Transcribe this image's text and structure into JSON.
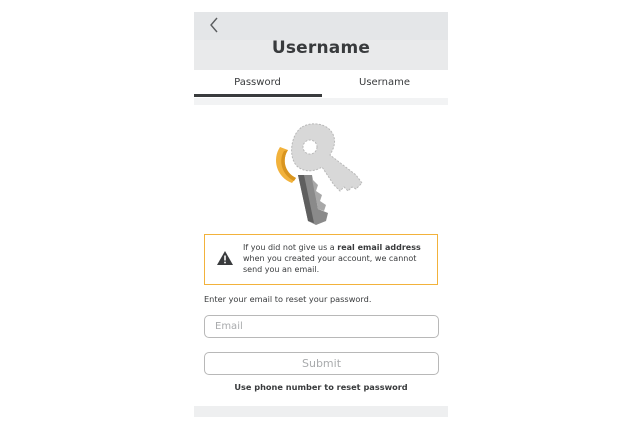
{
  "header": {
    "title": "Username",
    "back_icon": "chevron-left-icon"
  },
  "tabs": [
    {
      "label": "Password",
      "active": true
    },
    {
      "label": "Username",
      "active": false
    }
  ],
  "illustration": {
    "icon": "key-icon",
    "colors": {
      "ring": "#f2b23b",
      "key_gray": "#d4d4d4",
      "blade_dark": "#6e6e6e"
    }
  },
  "warning": {
    "icon": "warning-triangle-icon",
    "text_before": "If you did not give us a ",
    "text_bold": "real email address",
    "text_after": " when you created your account, we cannot send you an email.",
    "border_color": "#f2b23b"
  },
  "form": {
    "instruction": "Enter your email to reset your password.",
    "email_placeholder": "Email",
    "email_value": "",
    "submit_label": "Submit"
  },
  "links": {
    "phone_reset": "Use phone number to reset password"
  }
}
